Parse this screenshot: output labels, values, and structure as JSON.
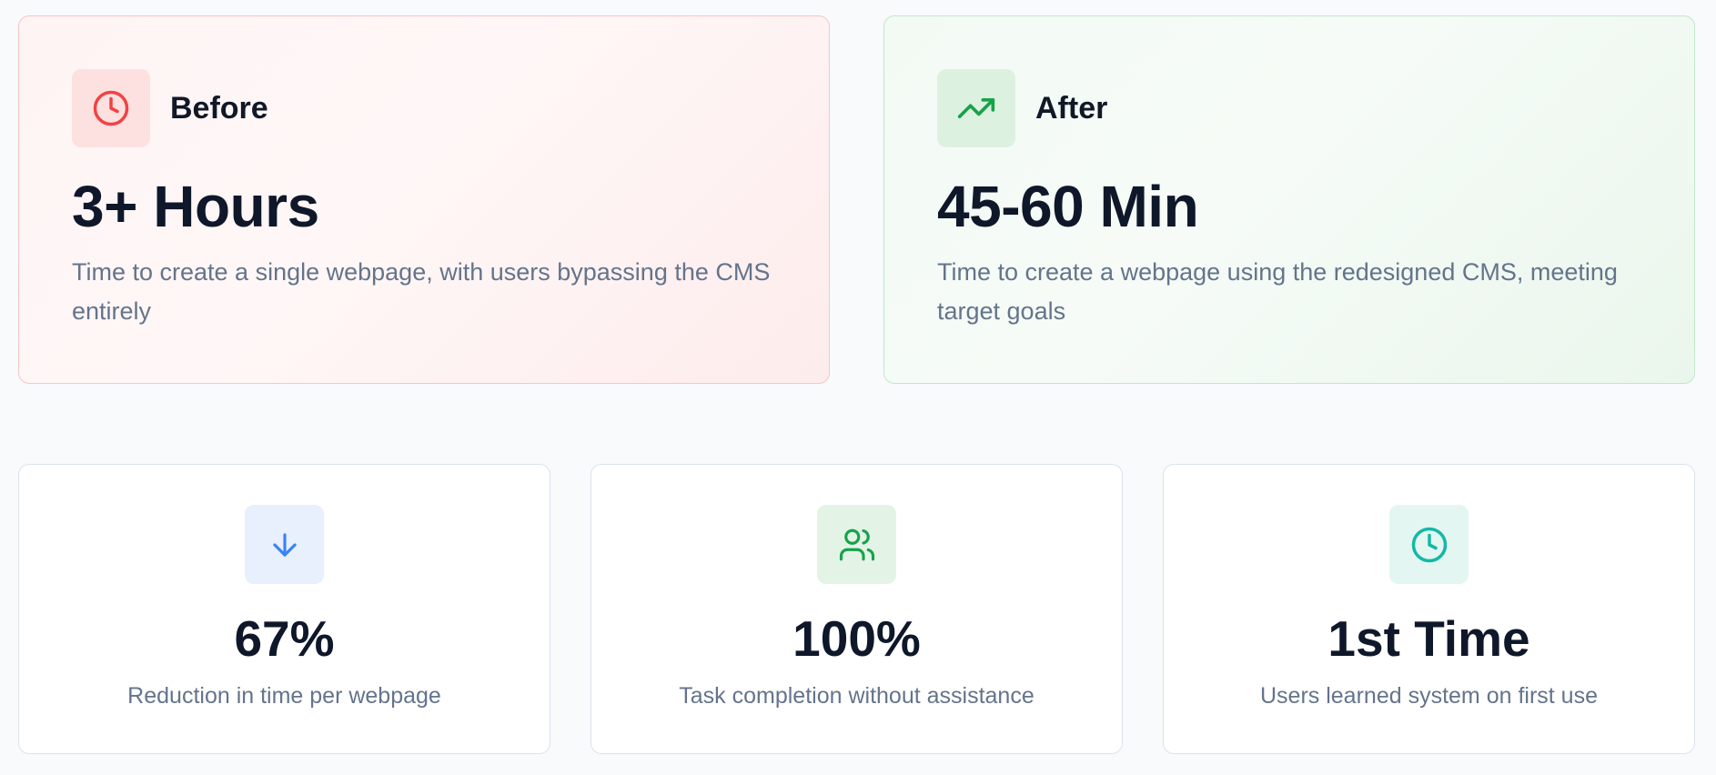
{
  "comparison": {
    "before": {
      "label": "Before",
      "value": "3+ Hours",
      "description": "Time to create a single webpage, with users bypassing the CMS entirely",
      "icon": "clock-icon",
      "accent": "#ef4444"
    },
    "after": {
      "label": "After",
      "value": "45-60 Min",
      "description": "Time to create a webpage using the redesigned CMS, meeting target goals",
      "icon": "trending-up-icon",
      "accent": "#16a34a"
    }
  },
  "stats": [
    {
      "value": "67%",
      "description": "Reduction in time per webpage",
      "icon": "arrow-down-icon",
      "accent": "#3b82f6"
    },
    {
      "value": "100%",
      "description": "Task completion without assistance",
      "icon": "users-icon",
      "accent": "#16a34a"
    },
    {
      "value": "1st Time",
      "description": "Users learned system on first use",
      "icon": "clock-icon",
      "accent": "#14b8a6"
    }
  ]
}
